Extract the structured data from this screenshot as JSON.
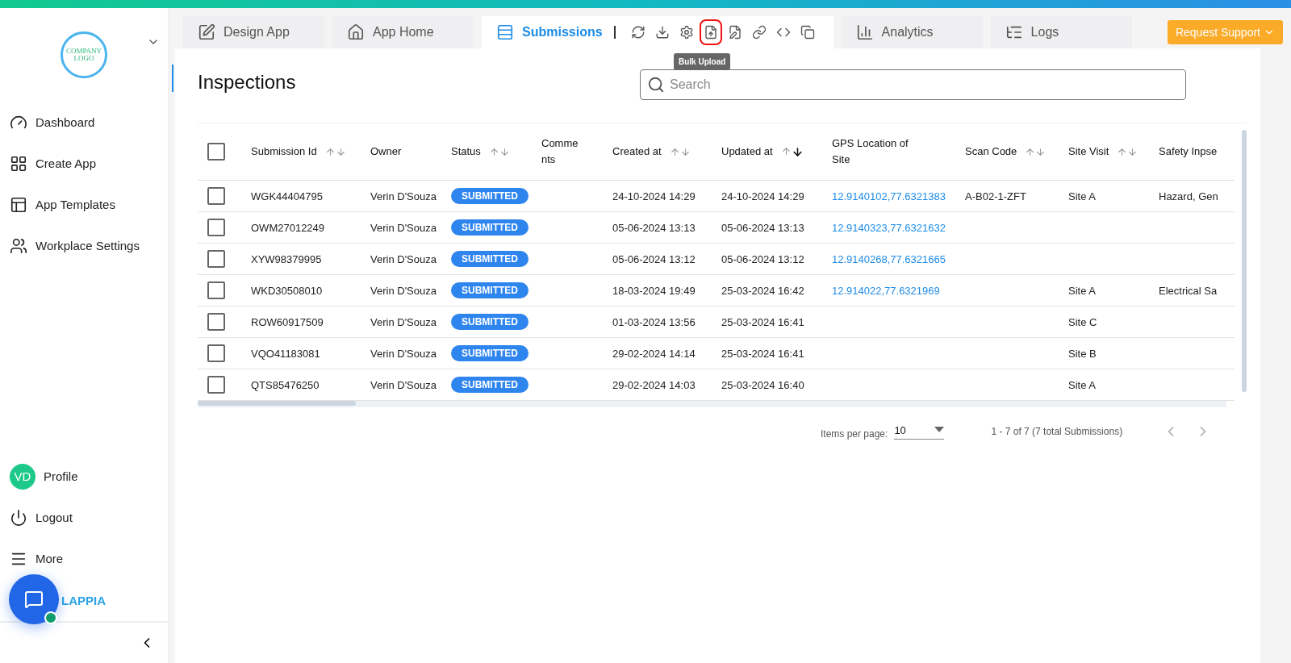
{
  "sidebar": {
    "logo_text": "COMPANY LOGO",
    "nav": [
      {
        "label": "Dashboard"
      },
      {
        "label": "Create App"
      },
      {
        "label": "App Templates"
      },
      {
        "label": "Workplace Settings"
      }
    ],
    "bottom": [
      {
        "label": "Profile",
        "avatar": "VD"
      },
      {
        "label": "Logout"
      },
      {
        "label": "More"
      }
    ],
    "brand": "LAPPIA"
  },
  "tabs": [
    {
      "label": "Design App",
      "selected": false
    },
    {
      "label": "App Home",
      "selected": false
    },
    {
      "label": "Submissions",
      "selected": true
    },
    {
      "label": "Analytics",
      "selected": false
    },
    {
      "label": "Logs",
      "selected": false
    }
  ],
  "toolbar": {
    "tools": [
      {
        "highlighted": false
      },
      {
        "highlighted": false
      },
      {
        "highlighted": false
      },
      {
        "highlighted": true
      },
      {
        "highlighted": false
      },
      {
        "highlighted": false
      },
      {
        "highlighted": false
      },
      {
        "highlighted": false
      }
    ],
    "tooltip": "Bulk Upload"
  },
  "support_button": "Request Support",
  "page_title": "Inspections",
  "search": {
    "placeholder": "Search"
  },
  "table": {
    "all_checked": false,
    "columns": [
      {
        "label": "Submission Id",
        "sortable": true,
        "sorted": false,
        "kind": "text"
      },
      {
        "label": "Owner",
        "sortable": false,
        "kind": "text"
      },
      {
        "label": "Status",
        "sortable": true,
        "sorted": false,
        "kind": "badge"
      },
      {
        "label": "Comme nts",
        "sortable": false,
        "kind": "text"
      },
      {
        "label": "Created at",
        "sortable": true,
        "sorted": false,
        "kind": "text"
      },
      {
        "label": "Updated at",
        "sortable": true,
        "sorted": true,
        "kind": "text"
      },
      {
        "label": "GPS Location of Site",
        "sortable": false,
        "kind": "link"
      },
      {
        "label": "Scan Code",
        "sortable": true,
        "sorted": false,
        "kind": "text"
      },
      {
        "label": "Site Visit",
        "sortable": true,
        "sorted": false,
        "kind": "text"
      },
      {
        "label": "Safety Inpse",
        "sortable": false,
        "kind": "text"
      }
    ],
    "rows": [
      {
        "checked": false,
        "cells": [
          "WGK44404795",
          "Verin D'Souza",
          "SUBMITTED",
          "",
          "24-10-2024 14:29",
          "24-10-2024 14:29",
          "12.9140102,77.6321383",
          "A-B02-1-ZFT",
          "Site A",
          "Hazard, Gen"
        ]
      },
      {
        "checked": false,
        "cells": [
          "OWM27012249",
          "Verin D'Souza",
          "SUBMITTED",
          "",
          "05-06-2024 13:13",
          "05-06-2024 13:13",
          "12.9140323,77.6321632",
          "",
          "",
          ""
        ]
      },
      {
        "checked": false,
        "cells": [
          "XYW98379995",
          "Verin D'Souza",
          "SUBMITTED",
          "",
          "05-06-2024 13:12",
          "05-06-2024 13:12",
          "12.9140268,77.6321665",
          "",
          "",
          ""
        ]
      },
      {
        "checked": false,
        "cells": [
          "WKD30508010",
          "Verin D'Souza",
          "SUBMITTED",
          "",
          "18-03-2024 19:49",
          "25-03-2024 16:42",
          "12.914022,77.6321969",
          "",
          "Site A",
          "Electrical Sa"
        ]
      },
      {
        "checked": false,
        "cells": [
          "ROW60917509",
          "Verin D'Souza",
          "SUBMITTED",
          "",
          "01-03-2024 13:56",
          "25-03-2024 16:41",
          "",
          "",
          "Site C",
          ""
        ]
      },
      {
        "checked": false,
        "cells": [
          "VQO41183081",
          "Verin D'Souza",
          "SUBMITTED",
          "",
          "29-02-2024 14:14",
          "25-03-2024 16:41",
          "",
          "",
          "Site B",
          ""
        ]
      },
      {
        "checked": false,
        "cells": [
          "QTS85476250",
          "Verin D'Souza",
          "SUBMITTED",
          "",
          "29-02-2024 14:03",
          "25-03-2024 16:40",
          "",
          "",
          "Site A",
          ""
        ]
      }
    ]
  },
  "pagination": {
    "label": "Items per page:",
    "per_page": "10",
    "range": "1 - 7 of 7 (7 total Submissions)"
  }
}
